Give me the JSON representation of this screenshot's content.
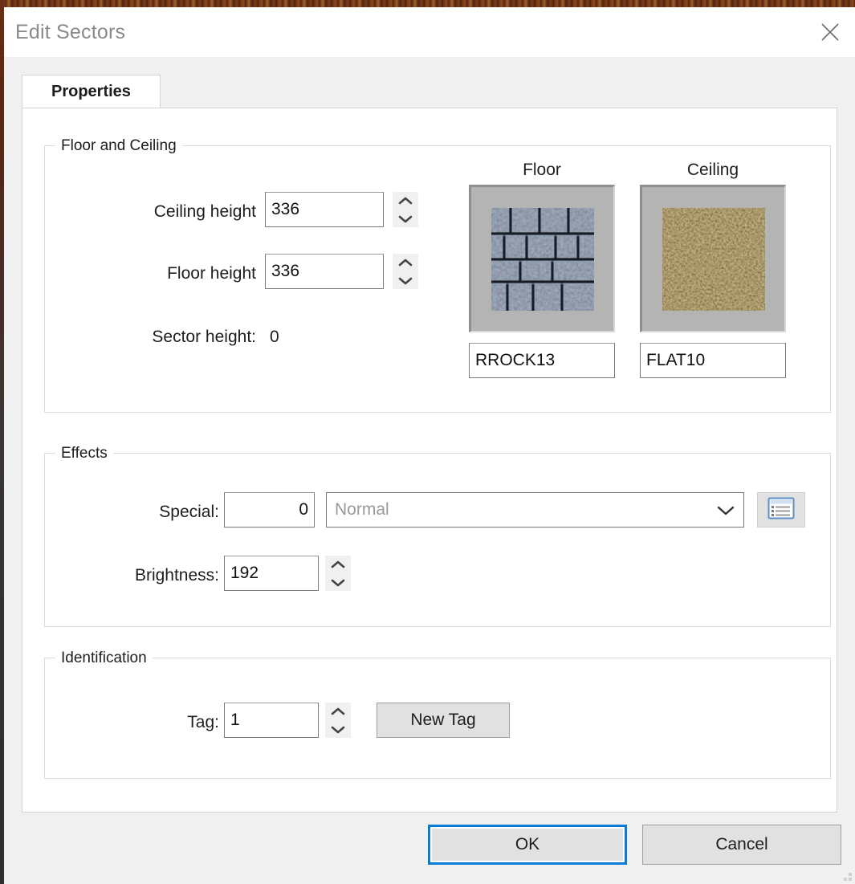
{
  "window": {
    "title": "Edit Sectors",
    "close_icon": "close-icon"
  },
  "tabs": [
    {
      "label": "Properties",
      "active": true
    }
  ],
  "groups": {
    "floor_and_ceiling": {
      "title": "Floor and Ceiling",
      "fields": [
        {
          "label": "Ceiling height",
          "value": "336",
          "spinner": true
        },
        {
          "label": "Floor height",
          "value": "336",
          "spinner": true
        }
      ],
      "sector_height_label": "Sector height:",
      "sector_height_value": "0",
      "textures": [
        {
          "caption": "Floor",
          "name": "RROCK13",
          "swatch_kind": "stone-cobble",
          "colors": [
            "#3c4758",
            "#5f6e82",
            "#8d9aab",
            "#1d242e",
            "#6f7d90"
          ]
        },
        {
          "caption": "Ceiling",
          "name": "FLAT10",
          "swatch_kind": "dirt-gravel",
          "colors": [
            "#3b2e17",
            "#7a6434",
            "#a08a4c",
            "#1c150a",
            "#60502a"
          ]
        }
      ]
    },
    "effects": {
      "title": "Effects",
      "special_label": "Special:",
      "special_value": "0",
      "special_type": "Normal",
      "special_browse_icon": "list-icon",
      "brightness_label": "Brightness:",
      "brightness_value": "192"
    },
    "identification": {
      "title": "Identification",
      "tag_label": "Tag:",
      "tag_value": "1",
      "new_tag_label": "New Tag"
    }
  },
  "footer": {
    "ok_label": "OK",
    "cancel_label": "Cancel"
  },
  "colors": {
    "accent": "#0a7bd4",
    "dialog_bg": "#f0f0f0",
    "page_bg": "#ffffff",
    "title_text": "#8a8a8a",
    "border": "#dcdcdc"
  }
}
